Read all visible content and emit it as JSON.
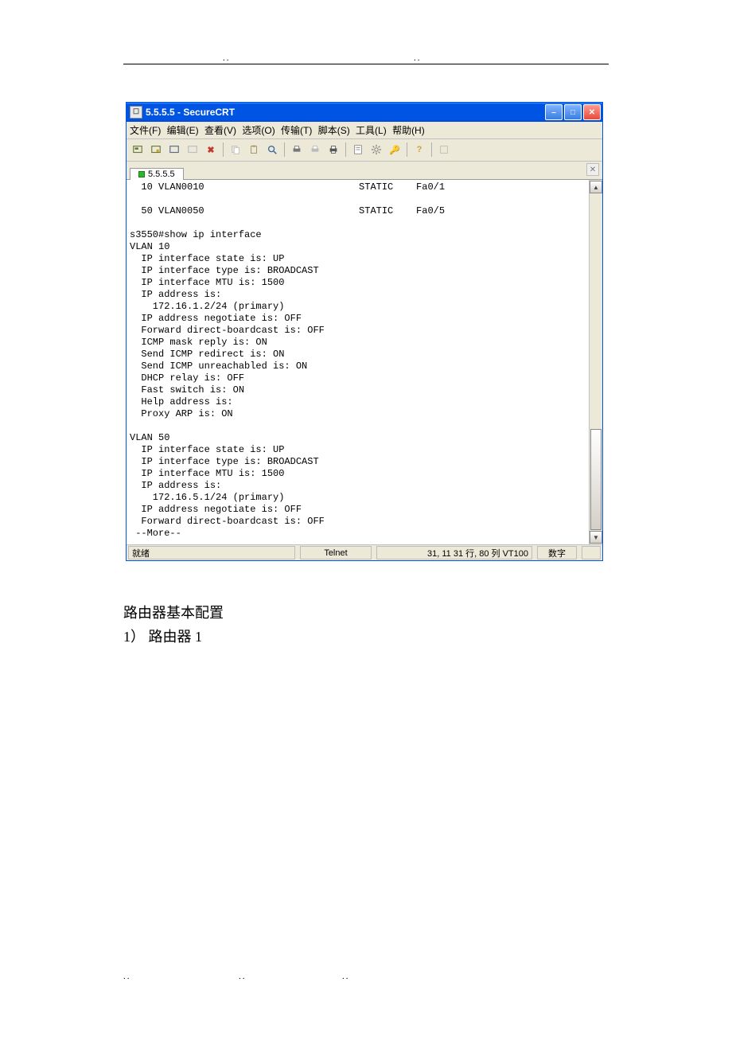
{
  "page": {
    "dots": "..",
    "heading1": "路由器基本配置",
    "heading2": "1） 路由器  1"
  },
  "window": {
    "title": "5.5.5.5 - SecureCRT",
    "menus": [
      "文件(F)",
      "编辑(E)",
      "查看(V)",
      "选项(O)",
      "传输(T)",
      "脚本(S)",
      "工具(L)",
      "帮助(H)"
    ],
    "tab_label": "5.5.5.5",
    "terminal": "  10 VLAN0010                           STATIC    Fa0/1\n\n  50 VLAN0050                           STATIC    Fa0/5\n\ns3550#show ip interface\nVLAN 10\n  IP interface state is: UP\n  IP interface type is: BROADCAST\n  IP interface MTU is: 1500\n  IP address is:\n    172.16.1.2/24 (primary)\n  IP address negotiate is: OFF\n  Forward direct-boardcast is: OFF\n  ICMP mask reply is: ON\n  Send ICMP redirect is: ON\n  Send ICMP unreachabled is: ON\n  DHCP relay is: OFF\n  Fast switch is: ON\n  Help address is:\n  Proxy ARP is: ON\n\nVLAN 50\n  IP interface state is: UP\n  IP interface type is: BROADCAST\n  IP interface MTU is: 1500\n  IP address is:\n    172.16.5.1/24 (primary)\n  IP address negotiate is: OFF\n  Forward direct-boardcast is: OFF\n --More--",
    "status": {
      "ready": "就绪",
      "protocol": "Telnet",
      "cursor": "31,  11  31 行,  80 列 VT100",
      "mode": "数字"
    }
  }
}
